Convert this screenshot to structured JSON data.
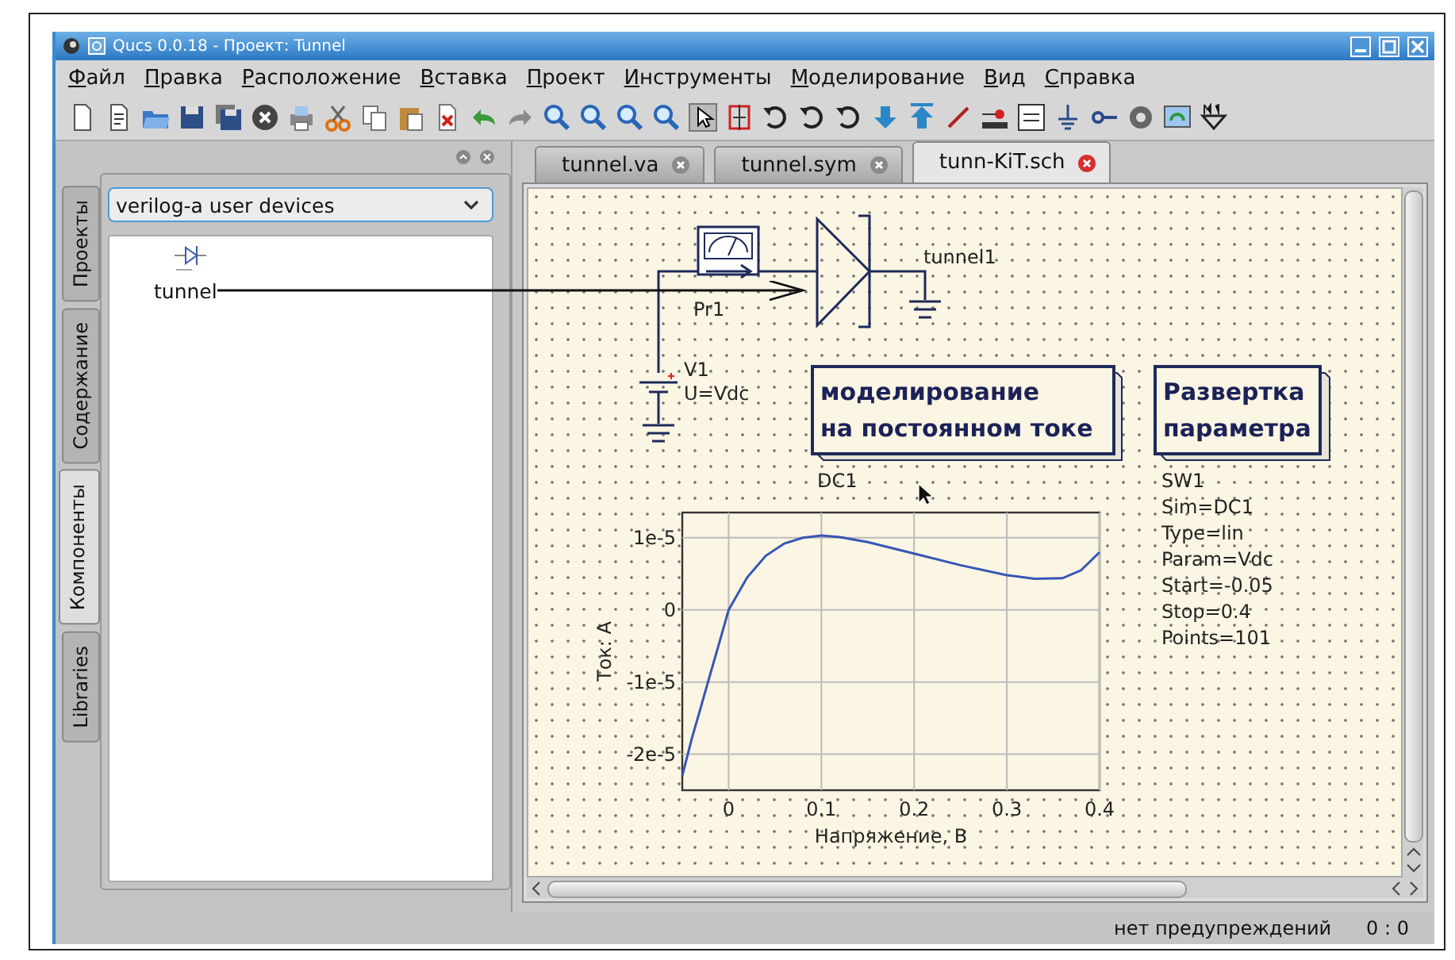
{
  "window": {
    "title": "Qucs 0.0.18 - Проект: Tunnel"
  },
  "menu": [
    "Файл",
    "Правка",
    "Расположение",
    "Вставка",
    "Проект",
    "Инструменты",
    "Моделирование",
    "Вид",
    "Справка"
  ],
  "side_tabs": [
    {
      "label": "Проекты",
      "selected": false
    },
    {
      "label": "Содержание",
      "selected": false
    },
    {
      "label": "Компоненты",
      "selected": true
    },
    {
      "label": "Libraries",
      "selected": false
    }
  ],
  "library_combo": {
    "value": "verilog-a user devices"
  },
  "components": [
    {
      "label": "tunnel"
    }
  ],
  "editor_tabs": [
    {
      "label": "tunnel.va",
      "selected": false
    },
    {
      "label": "tunnel.sym",
      "selected": false
    },
    {
      "label": "tunn-KiT.sch",
      "selected": true
    }
  ],
  "schematic": {
    "probe_label": "Pr1",
    "diode_label": "tunnel1",
    "source": {
      "name": "V1",
      "param": "U=Vdc"
    },
    "dc_sim": {
      "title_lines": [
        "моделирование",
        "на постоянном токе"
      ],
      "name": "DC1"
    },
    "sweep": {
      "title_lines": [
        "Развертка",
        "параметра"
      ],
      "params": [
        "SW1",
        "Sim=DC1",
        "Type=lin",
        "Param=Vdc",
        "Start=-0.05",
        "Stop=0.4",
        "Points=101"
      ]
    },
    "chart_data": {
      "type": "line",
      "grid": true,
      "xlabel": "Напряжение, В",
      "ylabel": "Ток: А",
      "xlim": [
        -0.05,
        0.4
      ],
      "ylim": [
        -2.5e-05,
        1.35e-05
      ],
      "xticks": [
        {
          "value": 0,
          "label": "0"
        },
        {
          "value": 0.1,
          "label": "0.1"
        },
        {
          "value": 0.2,
          "label": "0.2"
        },
        {
          "value": 0.3,
          "label": "0.3"
        },
        {
          "value": 0.4,
          "label": "0.4"
        }
      ],
      "yticks": [
        {
          "value": 1e-05,
          "label": "1e-5"
        },
        {
          "value": 0,
          "label": "0"
        },
        {
          "value": -1e-05,
          "label": "-1e-5"
        },
        {
          "value": -2e-05,
          "label": "-2e-5"
        }
      ],
      "x": [
        -0.05,
        -0.04,
        -0.03,
        -0.02,
        -0.01,
        0,
        0.02,
        0.04,
        0.06,
        0.08,
        0.1,
        0.12,
        0.15,
        0.2,
        0.25,
        0.3,
        0.33,
        0.36,
        0.38,
        0.4
      ],
      "series": [
        {
          "color": "#3556b5",
          "values": [
            -2.3e-05,
            -1.8e-05,
            -1.35e-05,
            -9e-06,
            -4.5e-06,
            0,
            4.5e-06,
            7.5e-06,
            9.2e-06,
            1e-05,
            1.03e-05,
            1.01e-05,
            9.4e-06,
            7.8e-06,
            6.2e-06,
            4.8e-06,
            4.3e-06,
            4.4e-06,
            5.5e-06,
            8e-06
          ]
        }
      ]
    }
  },
  "status_bar": {
    "message": "нет предупреждений",
    "position": "0 : 0"
  }
}
